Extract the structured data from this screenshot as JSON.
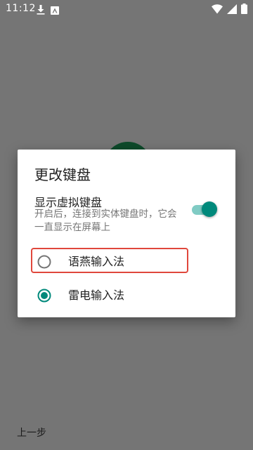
{
  "status_bar": {
    "time": "11:12",
    "icons": [
      "download-icon",
      "app-notification-icon",
      "wifi-icon",
      "cellular-signal-icon",
      "battery-icon"
    ]
  },
  "background": {
    "back_label": "上一步"
  },
  "dialog": {
    "title": "更改键盘",
    "setting": {
      "title": "显示虚拟键盘",
      "summary": "开启后，连接到实体键盘时，它会一直显示在屏幕上",
      "switch_on": true
    },
    "options": [
      {
        "label": "语燕输入法",
        "selected": false,
        "highlighted": true
      },
      {
        "label": "雷电输入法",
        "selected": true,
        "highlighted": false
      }
    ]
  },
  "colors": {
    "scrim": "#757575",
    "accent": "#00897b",
    "track": "#80cbc4",
    "highlight": "#e0473c",
    "bg_circle": "#0d4a2a"
  }
}
